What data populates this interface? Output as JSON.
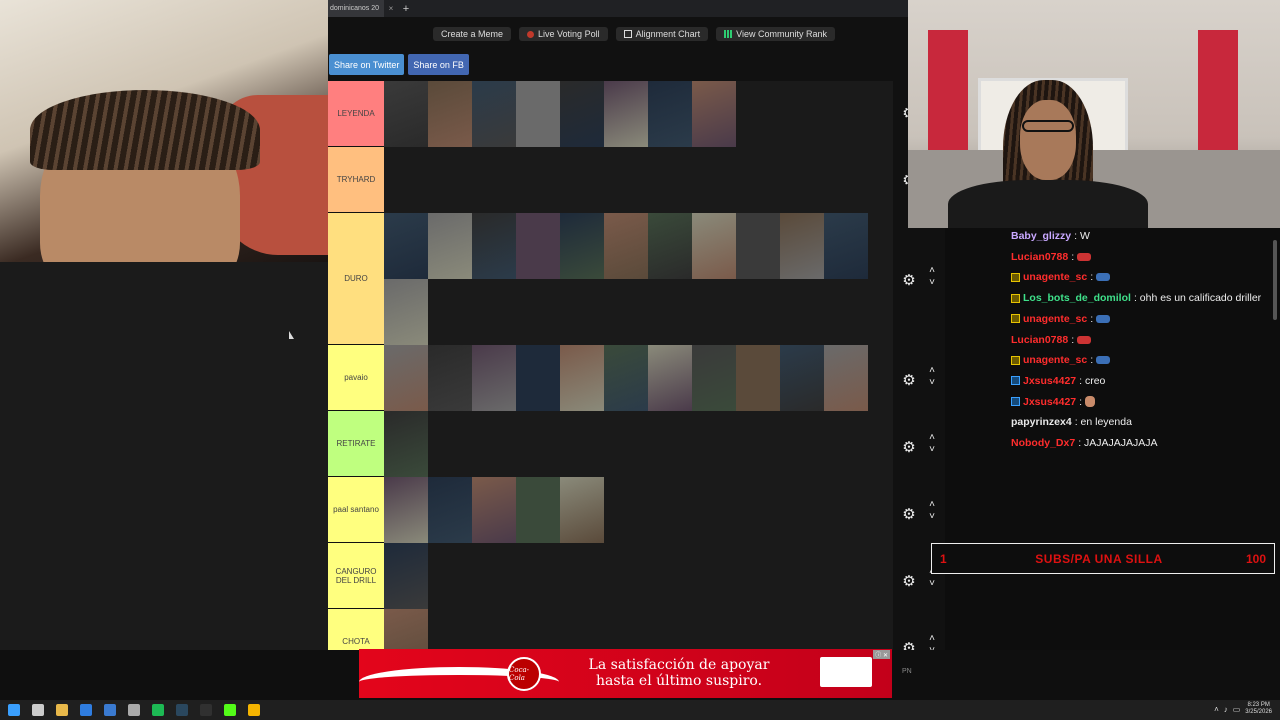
{
  "browser": {
    "tab_title": "dominicanos 20",
    "tab_close": "×",
    "tab_new": "+",
    "top_buttons": [
      "Create a Meme",
      "Live Voting Poll",
      "Alignment Chart",
      "View Community Rank"
    ],
    "share_twitter": "Share on Twitter",
    "share_fb": "Share on FB"
  },
  "tiers": [
    {
      "label": "LEYENDA",
      "color": "#ff7f7f",
      "items": 8
    },
    {
      "label": "TRYHARD",
      "color": "#ffbf7f",
      "items": 0
    },
    {
      "label": "DURO",
      "color": "#ffdf7f",
      "items": 12
    },
    {
      "label": "pavaio",
      "color": "#ffff7f",
      "items": 11
    },
    {
      "label": "RETIRATE",
      "color": "#bfff7f",
      "items": 1
    },
    {
      "label": "paal santano",
      "color": "#ffff7f",
      "items": 5
    },
    {
      "label": "CANGURO DEL DRILL",
      "color": "#ffff7f",
      "items": 1
    },
    {
      "label": "CHOTA",
      "color": "#ffff7f",
      "items": 1
    }
  ],
  "controls": {
    "gear": "⚙",
    "up": "˄",
    "down": "˅"
  },
  "ad": {
    "logo": "Coca-Cola",
    "line1": "La satisfacción de apoyar",
    "line2": "hasta el último suspiro.",
    "close": "ⓘ ✕"
  },
  "chat": [
    {
      "user": "Baby_glizzy",
      "color": "#c9a8ff",
      "badge": null,
      "msg": ": W",
      "emote": null
    },
    {
      "user": "Lucian0788",
      "color": "#ff2d2d",
      "badge": null,
      "msg": " : ",
      "emote": "hat"
    },
    {
      "user": "unagente_sc",
      "color": "#ff2d2d",
      "badge": "gold",
      "msg": " : ",
      "emote": "car"
    },
    {
      "user": "Los_bots_de_domilol",
      "color": "#3fe08a",
      "badge": "gold",
      "msg": " : ohh es un calificado driller",
      "emote": null
    },
    {
      "user": "unagente_sc",
      "color": "#ff2d2d",
      "badge": "gold",
      "msg": " : ",
      "emote": "car"
    },
    {
      "user": "Lucian0788",
      "color": "#ff2d2d",
      "badge": null,
      "msg": " : ",
      "emote": "hat"
    },
    {
      "user": "unagente_sc",
      "color": "#ff2d2d",
      "badge": "gold",
      "msg": " : ",
      "emote": "car"
    },
    {
      "user": "Jxsus4427",
      "color": "#ff2d2d",
      "badge": "blue",
      "msg": " : creo",
      "emote": null
    },
    {
      "user": "Jxsus4427",
      "color": "#ff2d2d",
      "badge": "blue",
      "msg": " : ",
      "emote": "hand"
    },
    {
      "user": "papyrinzex4",
      "color": "#e8e8e8",
      "badge": null,
      "msg": " : en leyenda",
      "emote": null
    },
    {
      "user": "Nobody_Dx7",
      "color": "#ff2d2d",
      "badge": null,
      "msg": " : JAJAJAJAJAJA",
      "emote": null
    }
  ],
  "goal": {
    "left": "1",
    "text": "SUBS/PA UNA SILLA",
    "right": "100",
    "color": "#d11"
  },
  "pn_label": "PN",
  "taskbar": {
    "clock_time": "8:23 PM",
    "clock_date": "3/25/2026",
    "icons": [
      "windows-icon",
      "search-icon",
      "file-explorer-icon",
      "edge-icon",
      "store-icon",
      "pen-icon",
      "spotify-icon",
      "steam-icon",
      "obs-icon",
      "kick-icon",
      "chrome-icon"
    ]
  }
}
